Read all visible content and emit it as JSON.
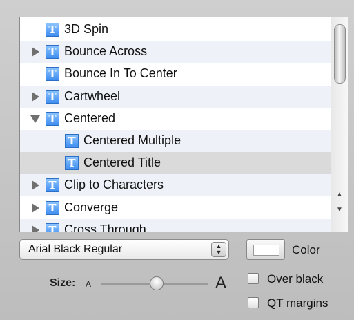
{
  "effects": {
    "items": [
      {
        "label": "3D Spin",
        "disclosure": "none",
        "level": 0
      },
      {
        "label": "Bounce Across",
        "disclosure": "closed",
        "level": 0
      },
      {
        "label": "Bounce In To Center",
        "disclosure": "none",
        "level": 0
      },
      {
        "label": "Cartwheel",
        "disclosure": "closed",
        "level": 0
      },
      {
        "label": "Centered",
        "disclosure": "open",
        "level": 0
      },
      {
        "label": "Centered Multiple",
        "disclosure": "none",
        "level": 1
      },
      {
        "label": "Centered Title",
        "disclosure": "none",
        "level": 1,
        "selected": true
      },
      {
        "label": "Clip to Characters",
        "disclosure": "closed",
        "level": 0
      },
      {
        "label": "Converge",
        "disclosure": "closed",
        "level": 0
      },
      {
        "label": "Cross Through",
        "disclosure": "closed",
        "level": 0
      }
    ],
    "icon_glyph": "T"
  },
  "font": {
    "selected": "Arial Black Regular"
  },
  "color": {
    "label": "Color"
  },
  "size": {
    "label": "Size:",
    "small_glyph": "A",
    "large_glyph": "A",
    "value_fraction": 0.55
  },
  "options": {
    "over_black": {
      "label": "Over black",
      "checked": false
    },
    "qt_margins": {
      "label": "QT margins",
      "checked": false
    }
  },
  "scrollbar": {
    "up": "▲",
    "down": "▼"
  }
}
